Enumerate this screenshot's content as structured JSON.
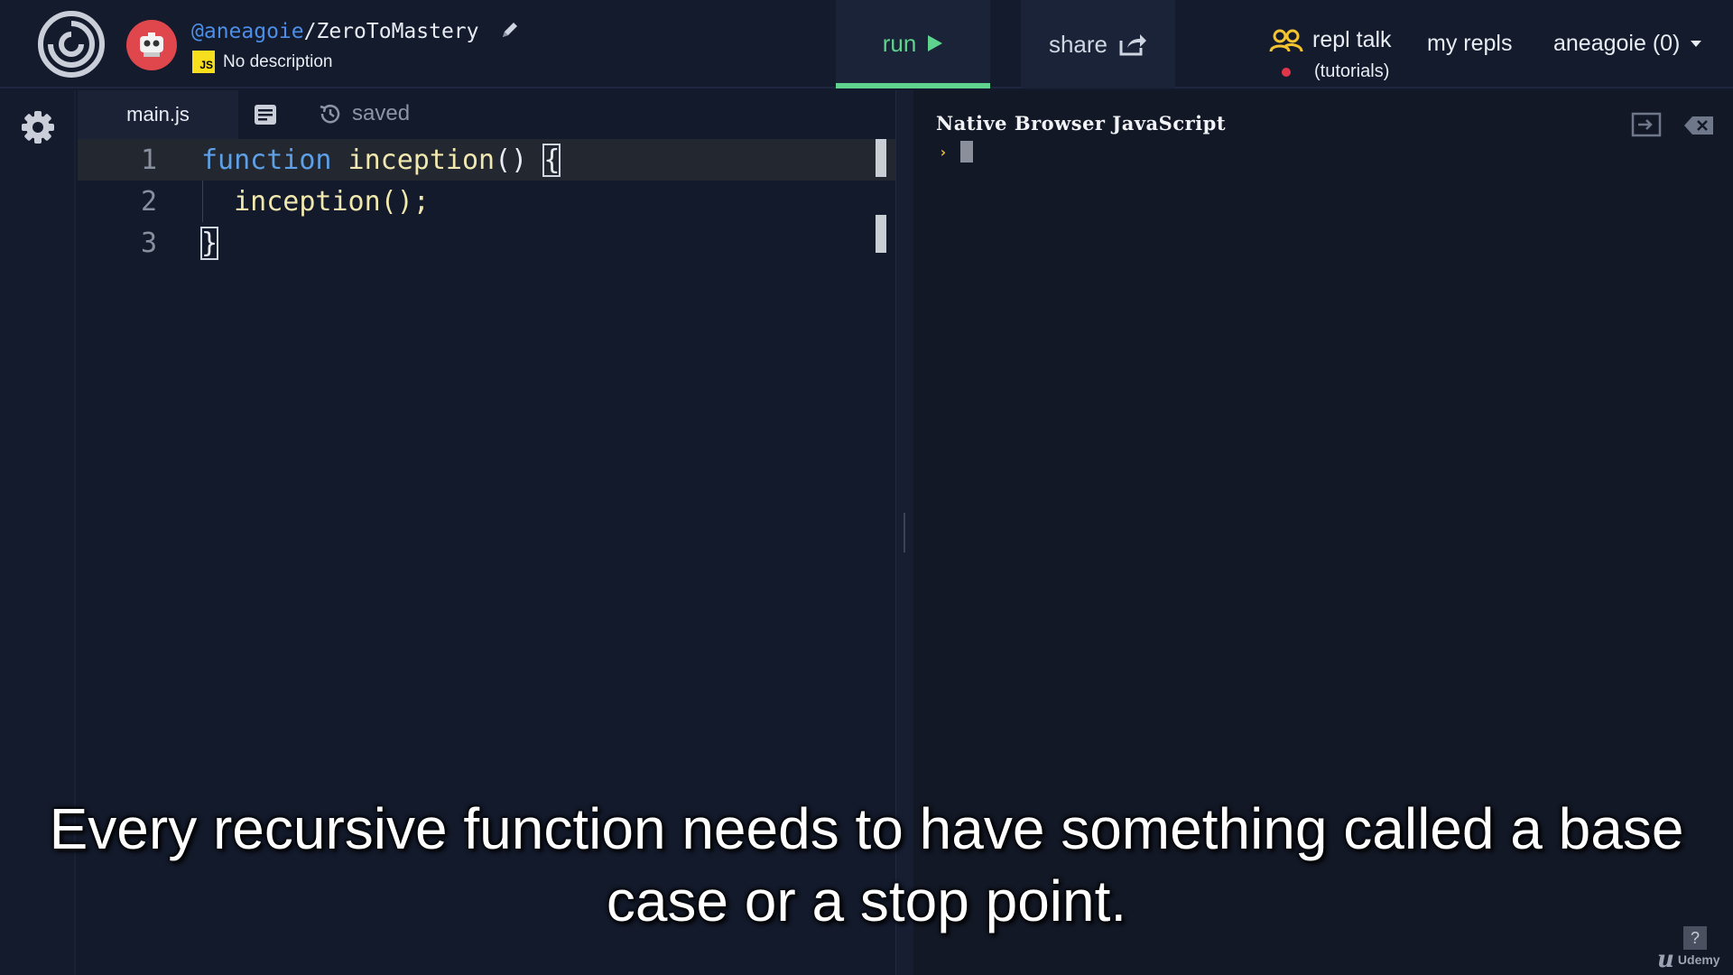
{
  "header": {
    "repl_owner": "@aneagoie",
    "repl_separator": "/",
    "repl_name": "ZeroToMastery",
    "language_badge": "JS",
    "description": "No description",
    "run_label": "run",
    "share_label": "share",
    "repl_talk_label": "repl talk",
    "repl_talk_sub": "(tutorials)",
    "my_repls_label": "my repls",
    "user_menu_label": "aneagoie (0)"
  },
  "editor": {
    "tab_label": "main.js",
    "status": "saved",
    "lines": [
      {
        "number": "1",
        "keyword": "function",
        "name": " inception",
        "rest": "() ",
        "brace": "{"
      },
      {
        "number": "2",
        "text": "  inception();"
      },
      {
        "number": "3",
        "brace": "}"
      }
    ]
  },
  "console": {
    "title": "Native Browser JavaScript",
    "prompt": "›"
  },
  "subtitle": {
    "line1": "Every recursive function needs to have something called a base",
    "line2": "case or a stop point."
  },
  "watermark": {
    "brand": "Udemy",
    "help": "?"
  },
  "colors": {
    "background": "#131a2b",
    "run_accent": "#5fd38d",
    "keyword": "#5e9fe6",
    "function_name": "#f1e8b0",
    "avatar": "#e0474c",
    "js_badge": "#f7df1e"
  },
  "icons": [
    "replit-logo-icon",
    "robot-avatar-icon",
    "pencil-icon",
    "play-icon",
    "share-icon",
    "community-icon",
    "chevron-down-icon",
    "gear-icon",
    "document-icon",
    "history-icon",
    "expand-panel-icon",
    "clear-console-icon"
  ]
}
